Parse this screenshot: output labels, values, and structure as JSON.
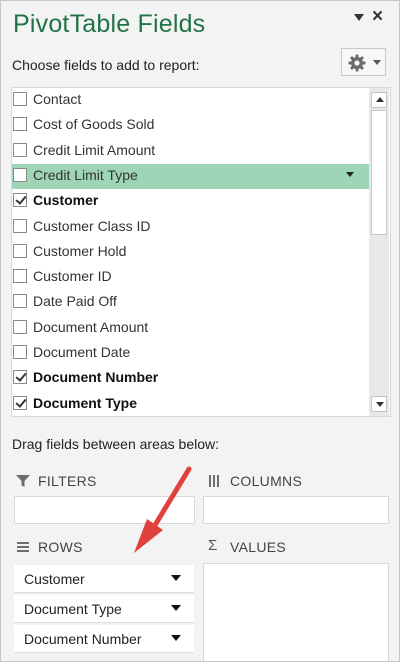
{
  "pane": {
    "title": "PivotTable Fields",
    "subtitle": "Choose fields to add to report:",
    "tools_icon": "gear-icon",
    "close_glyph": "×"
  },
  "fields": [
    {
      "label": "Contact",
      "checked": false,
      "highlighted": false
    },
    {
      "label": "Cost of Goods Sold",
      "checked": false,
      "highlighted": false
    },
    {
      "label": "Credit Limit Amount",
      "checked": false,
      "highlighted": false
    },
    {
      "label": "Credit Limit Type",
      "checked": false,
      "highlighted": true
    },
    {
      "label": "Customer",
      "checked": true,
      "highlighted": false
    },
    {
      "label": "Customer Class ID",
      "checked": false,
      "highlighted": false
    },
    {
      "label": "Customer Hold",
      "checked": false,
      "highlighted": false
    },
    {
      "label": "Customer ID",
      "checked": false,
      "highlighted": false
    },
    {
      "label": "Date Paid Off",
      "checked": false,
      "highlighted": false
    },
    {
      "label": "Document Amount",
      "checked": false,
      "highlighted": false
    },
    {
      "label": "Document Date",
      "checked": false,
      "highlighted": false
    },
    {
      "label": "Document Number",
      "checked": true,
      "highlighted": false
    },
    {
      "label": "Document Type",
      "checked": true,
      "highlighted": false
    }
  ],
  "areas": {
    "drag_label": "Drag fields between areas below:",
    "filters": {
      "label": "FILTERS",
      "icon": "filter-icon"
    },
    "columns": {
      "label": "COLUMNS",
      "icon": "columns-icon"
    },
    "rows": {
      "label": "ROWS",
      "icon": "rows-icon",
      "items": [
        "Customer",
        "Document Type",
        "Document Number"
      ]
    },
    "values": {
      "label": "VALUES",
      "icon": "sigma-icon",
      "glyph": "Σ"
    }
  },
  "colors": {
    "title": "#217346",
    "highlight": "#9fd5b7",
    "arrow": "#e0413a"
  }
}
